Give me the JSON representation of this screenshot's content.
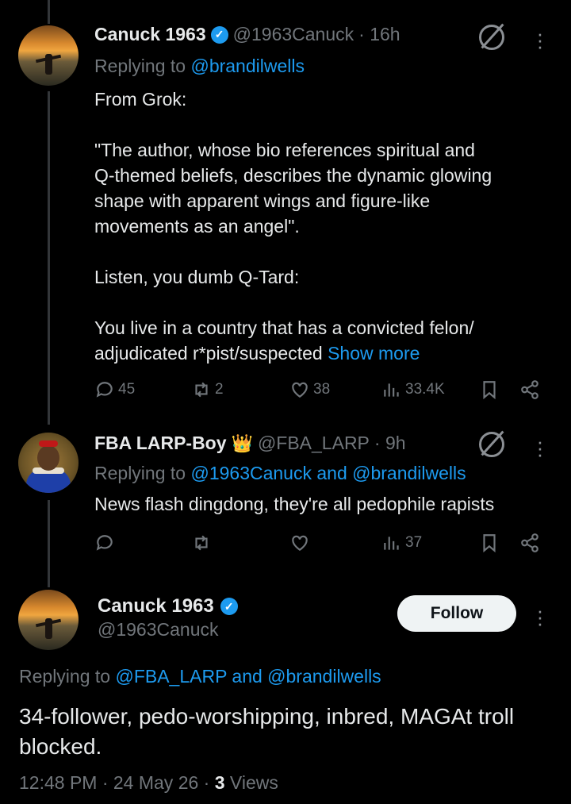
{
  "tweet1": {
    "name": "Canuck 1963",
    "handle": "@1963Canuck",
    "time": "· 16h",
    "replying_prefix": "Replying to",
    "replying_handles": "@brandilwells",
    "lines": [
      "From Grok:",
      "",
      "\"The author, whose bio references spiritual and",
      "Q-themed beliefs, describes the dynamic glowing",
      "shape with apparent wings and figure-like",
      "movements as an angel\".",
      "",
      "Listen, you dumb Q-Tard:",
      "",
      "You live in a country that has a convicted felon/"
    ],
    "last_line": "adjudicated r*pist/suspected",
    "show_more": "Show more",
    "stats": {
      "replies": "45",
      "reposts": "2",
      "likes": "38",
      "views": "33.4K"
    }
  },
  "tweet2": {
    "name": "FBA LARP-Boy",
    "emoji": "👑",
    "handle": "@FBA_LARP",
    "time": "· 9h",
    "replying_prefix": "Replying to",
    "replying_handles": "@1963Canuck and @brandilwells",
    "text": "News flash dingdong, they're all pedophile rapists",
    "stats": {
      "views": "37"
    }
  },
  "main": {
    "name": "Canuck 1963",
    "handle": "@1963Canuck",
    "follow_label": "Follow",
    "replying_prefix": "Replying to",
    "replying_handles": "@FBA_LARP and @brandilwells",
    "text": "34-follower, pedo-worshipping, inbred, MAGAt troll blocked.",
    "meta_time": "12:48 PM · 24 May 26 ·",
    "meta_views_count": "3",
    "meta_views_label": "Views"
  },
  "colors": {
    "accent": "#1d9bf0",
    "muted": "#71767b",
    "text": "#e7e9ea",
    "background": "#000000"
  },
  "icons": [
    "grok-icon",
    "more-icon",
    "reply-icon",
    "repost-icon",
    "like-icon",
    "views-icon",
    "bookmark-icon",
    "share-icon",
    "verified-icon"
  ]
}
